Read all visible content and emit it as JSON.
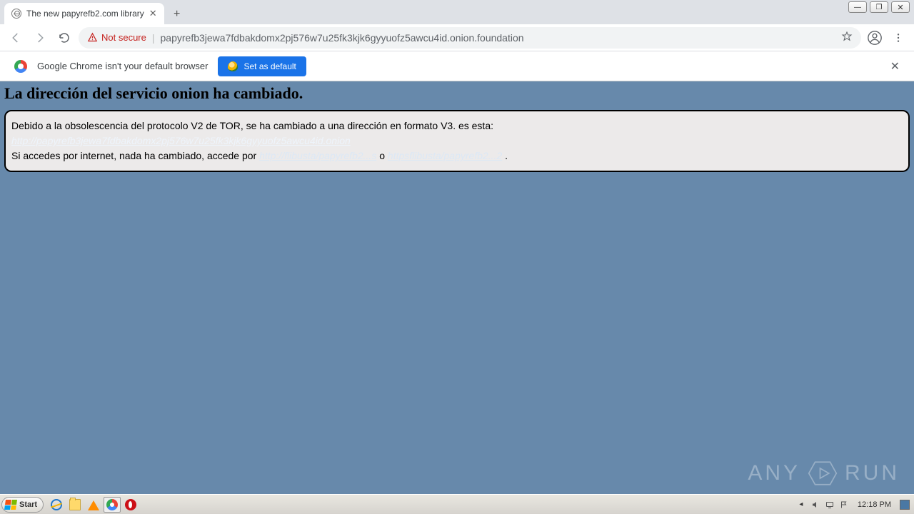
{
  "window": {
    "minimize": "—",
    "maximize": "❐",
    "close": "✕"
  },
  "tab": {
    "title": "The new papyrefb2.com library",
    "close": "✕",
    "new": "+"
  },
  "toolbar": {
    "not_secure": "Not secure",
    "url": "papyrefb3jewa7fdbakdomx2pj576w7u25fk3kjk6gyyuofz5awcu4id.onion.foundation"
  },
  "infobar": {
    "message": "Google Chrome isn't your default browser",
    "button": "Set as default",
    "close": "✕"
  },
  "page": {
    "heading": "La dirección del servicio onion ha cambiado.",
    "line1": "Debido a la obsolescencia del protocolo V2 de TOR, se ha cambiado a una dirección en formato V3. es esta:",
    "link_onion": "http://papyrefb3jewa7fdbakdomx2pj576w7u25fk3kjk6gyyuofz5awcu4id.onion",
    "line2a": "Si accedes por internet, nada ha cambiado, accede por ",
    "link_a": "http://flibusta/papyrefb2...s",
    "sep": " o ",
    "link_b": "httpsflibusta/papyrefb2...2",
    "tail": " ."
  },
  "watermark": {
    "text": "ANY",
    "text2": "RUN"
  },
  "taskbar": {
    "start": "Start",
    "clock": "12:18 PM"
  }
}
